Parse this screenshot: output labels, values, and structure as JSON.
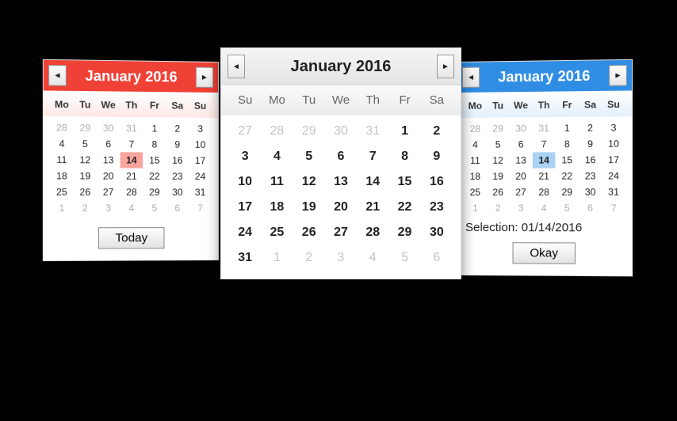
{
  "left": {
    "title": "January 2016",
    "week_start": "Mo",
    "dow": [
      "Mo",
      "Tu",
      "We",
      "Th",
      "Fr",
      "Sa",
      "Su"
    ],
    "weeks": [
      [
        {
          "n": 28,
          "o": true
        },
        {
          "n": 29,
          "o": true
        },
        {
          "n": 30,
          "o": true
        },
        {
          "n": 31,
          "o": true
        },
        {
          "n": 1
        },
        {
          "n": 2
        },
        {
          "n": 3
        }
      ],
      [
        {
          "n": 4
        },
        {
          "n": 5
        },
        {
          "n": 6
        },
        {
          "n": 7
        },
        {
          "n": 8
        },
        {
          "n": 9
        },
        {
          "n": 10
        }
      ],
      [
        {
          "n": 11
        },
        {
          "n": 12
        },
        {
          "n": 13
        },
        {
          "n": 14,
          "sel": true
        },
        {
          "n": 15
        },
        {
          "n": 16
        },
        {
          "n": 17
        }
      ],
      [
        {
          "n": 18
        },
        {
          "n": 19
        },
        {
          "n": 20
        },
        {
          "n": 21
        },
        {
          "n": 22
        },
        {
          "n": 23
        },
        {
          "n": 24
        }
      ],
      [
        {
          "n": 25
        },
        {
          "n": 26
        },
        {
          "n": 27
        },
        {
          "n": 28
        },
        {
          "n": 29
        },
        {
          "n": 30
        },
        {
          "n": 31
        }
      ],
      [
        {
          "n": 1,
          "o": true
        },
        {
          "n": 2,
          "o": true
        },
        {
          "n": 3,
          "o": true
        },
        {
          "n": 4,
          "o": true
        },
        {
          "n": 5,
          "o": true
        },
        {
          "n": 6,
          "o": true
        },
        {
          "n": 7,
          "o": true
        }
      ]
    ],
    "footer_button": "Today"
  },
  "center": {
    "title": "January 2016",
    "week_start": "Su",
    "dow": [
      "Su",
      "Mo",
      "Tu",
      "We",
      "Th",
      "Fr",
      "Sa"
    ],
    "weeks": [
      [
        {
          "n": 27,
          "o": true
        },
        {
          "n": 28,
          "o": true
        },
        {
          "n": 29,
          "o": true
        },
        {
          "n": 30,
          "o": true
        },
        {
          "n": 31,
          "o": true
        },
        {
          "n": 1
        },
        {
          "n": 2
        }
      ],
      [
        {
          "n": 3
        },
        {
          "n": 4
        },
        {
          "n": 5
        },
        {
          "n": 6
        },
        {
          "n": 7
        },
        {
          "n": 8
        },
        {
          "n": 9
        }
      ],
      [
        {
          "n": 10
        },
        {
          "n": 11
        },
        {
          "n": 12
        },
        {
          "n": 13
        },
        {
          "n": 14
        },
        {
          "n": 15
        },
        {
          "n": 16
        }
      ],
      [
        {
          "n": 17
        },
        {
          "n": 18
        },
        {
          "n": 19
        },
        {
          "n": 20
        },
        {
          "n": 21
        },
        {
          "n": 22
        },
        {
          "n": 23
        }
      ],
      [
        {
          "n": 24
        },
        {
          "n": 25
        },
        {
          "n": 26
        },
        {
          "n": 27
        },
        {
          "n": 28
        },
        {
          "n": 29
        },
        {
          "n": 30
        }
      ],
      [
        {
          "n": 31
        },
        {
          "n": 1,
          "o": true
        },
        {
          "n": 2,
          "o": true
        },
        {
          "n": 3,
          "o": true
        },
        {
          "n": 4,
          "o": true
        },
        {
          "n": 5,
          "o": true
        },
        {
          "n": 6,
          "o": true
        }
      ]
    ]
  },
  "right": {
    "title": "January 2016",
    "week_start": "Mo",
    "dow": [
      "Mo",
      "Tu",
      "We",
      "Th",
      "Fr",
      "Sa",
      "Su"
    ],
    "weeks": [
      [
        {
          "n": 28,
          "o": true
        },
        {
          "n": 29,
          "o": true
        },
        {
          "n": 30,
          "o": true
        },
        {
          "n": 31,
          "o": true
        },
        {
          "n": 1
        },
        {
          "n": 2
        },
        {
          "n": 3
        }
      ],
      [
        {
          "n": 4
        },
        {
          "n": 5
        },
        {
          "n": 6
        },
        {
          "n": 7
        },
        {
          "n": 8
        },
        {
          "n": 9
        },
        {
          "n": 10
        }
      ],
      [
        {
          "n": 11
        },
        {
          "n": 12
        },
        {
          "n": 13
        },
        {
          "n": 14,
          "sel": true
        },
        {
          "n": 15
        },
        {
          "n": 16
        },
        {
          "n": 17
        }
      ],
      [
        {
          "n": 18
        },
        {
          "n": 19
        },
        {
          "n": 20
        },
        {
          "n": 21
        },
        {
          "n": 22
        },
        {
          "n": 23
        },
        {
          "n": 24
        }
      ],
      [
        {
          "n": 25
        },
        {
          "n": 26
        },
        {
          "n": 27
        },
        {
          "n": 28
        },
        {
          "n": 29
        },
        {
          "n": 30
        },
        {
          "n": 31
        }
      ],
      [
        {
          "n": 1,
          "o": true
        },
        {
          "n": 2,
          "o": true
        },
        {
          "n": 3,
          "o": true
        },
        {
          "n": 4,
          "o": true
        },
        {
          "n": 5,
          "o": true
        },
        {
          "n": 6,
          "o": true
        },
        {
          "n": 7,
          "o": true
        }
      ]
    ],
    "selection_label": "Selection: 01/14/2016",
    "footer_button": "Okay"
  }
}
